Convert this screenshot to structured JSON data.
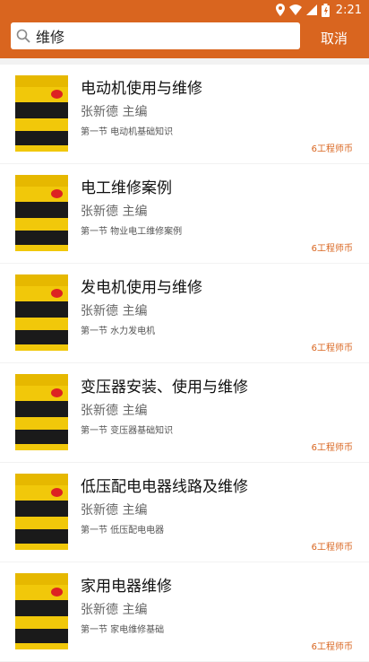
{
  "status": {
    "time": "2:21"
  },
  "search": {
    "value": "维修",
    "cancel_label": "取消"
  },
  "books": [
    {
      "title": "电动机使用与维修",
      "author": "张新德  主编",
      "chapter": "第一节 电动机基础知识",
      "price": "6工程师币"
    },
    {
      "title": "电工维修案例",
      "author": "张新德  主编",
      "chapter": "第一节 物业电工维修案例",
      "price": "6工程师币"
    },
    {
      "title": "发电机使用与维修",
      "author": "张新德  主编",
      "chapter": "第一节 水力发电机",
      "price": "6工程师币"
    },
    {
      "title": "变压器安装、使用与维修",
      "author": "张新德  主编",
      "chapter": "第一节 变压器基础知识",
      "price": "6工程师币"
    },
    {
      "title": "低压配电电器线路及维修",
      "author": "张新德  主编",
      "chapter": "第一节 低压配电电器",
      "price": "6工程师币"
    },
    {
      "title": "家用电器维修",
      "author": "张新德  主编",
      "chapter": "第一节 家电维修基础",
      "price": "6工程师币"
    }
  ]
}
